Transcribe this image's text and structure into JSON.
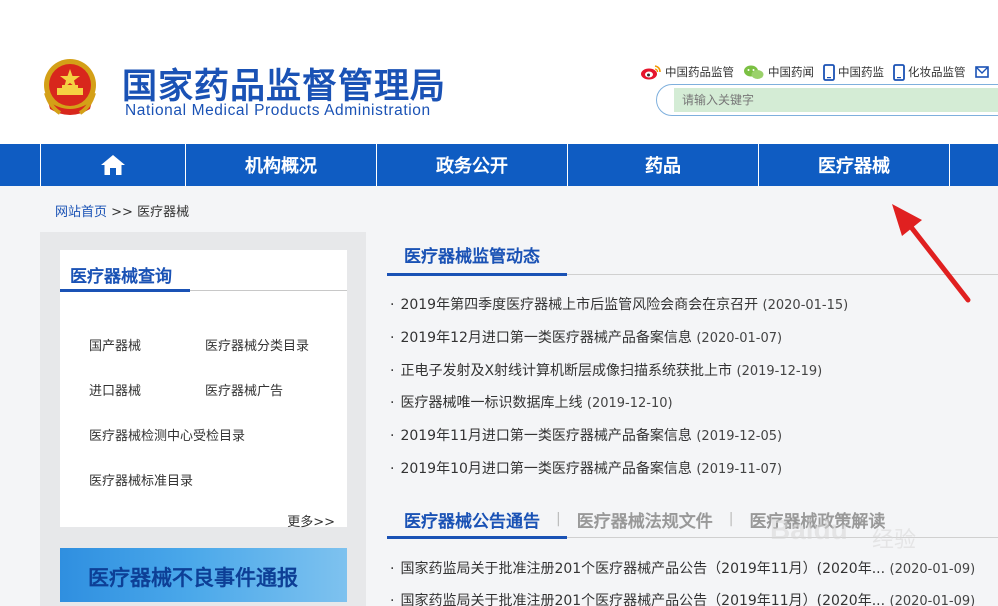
{
  "header": {
    "title_cn": "国家药品监督管理局",
    "title_en": "National Medical Products Administration",
    "links": [
      {
        "label": "中国药品监管",
        "icon": "weibo-icon"
      },
      {
        "label": "中国药闻",
        "icon": "wechat-icon"
      },
      {
        "label": "中国药监",
        "icon": "mobile-icon"
      },
      {
        "label": "化妆品监管",
        "icon": "mobile-icon"
      }
    ],
    "search_placeholder": "请输入关键字"
  },
  "nav": {
    "items": [
      "机构概况",
      "政务公开",
      "药品",
      "医疗器械"
    ]
  },
  "breadcrumb": {
    "home": "网站首页",
    "sep": " >> ",
    "current": "医疗器械"
  },
  "query": {
    "title": "医疗器械查询",
    "links": [
      "国产器械",
      "医疗器械分类目录",
      "进口器械",
      "医疗器械广告",
      "医疗器械检测中心受检目录",
      "医疗器械标准目录"
    ],
    "more": "更多>>"
  },
  "banner": {
    "text": "医疗器械不良事件通报"
  },
  "section1": {
    "title": "医疗器械监管动态",
    "news": [
      {
        "title": "2019年第四季度医疗器械上市后监管风险会商会在京召开",
        "date": "(2020-01-15)"
      },
      {
        "title": "2019年12月进口第一类医疗器械产品备案信息",
        "date": "(2020-01-07)"
      },
      {
        "title": "正电子发射及X射线计算机断层成像扫描系统获批上市",
        "date": "(2019-12-19)"
      },
      {
        "title": "医疗器械唯一标识数据库上线",
        "date": "(2019-12-10)"
      },
      {
        "title": "2019年11月进口第一类医疗器械产品备案信息",
        "date": "(2019-12-05)"
      },
      {
        "title": "2019年10月进口第一类医疗器械产品备案信息",
        "date": "(2019-11-07)"
      }
    ]
  },
  "section2": {
    "tabs": [
      "医疗器械公告通告",
      "医疗器械法规文件",
      "医疗器械政策解读"
    ],
    "news": [
      {
        "title": "国家药监局关于批准注册201个医疗器械产品公告（2019年11月）(2020年...",
        "date": "(2020-01-09)"
      },
      {
        "title": "国家药监局关于批准注册201个医疗器械产品公告（2019年11月）(2020年...",
        "date": "(2020-01-09)"
      }
    ]
  },
  "watermark": {
    "text": "Baidu",
    "sub": "经验"
  },
  "colors": {
    "brand_blue": "#1a52b5",
    "nav_blue": "#0f5cc2",
    "arrow_red": "#e02020"
  }
}
